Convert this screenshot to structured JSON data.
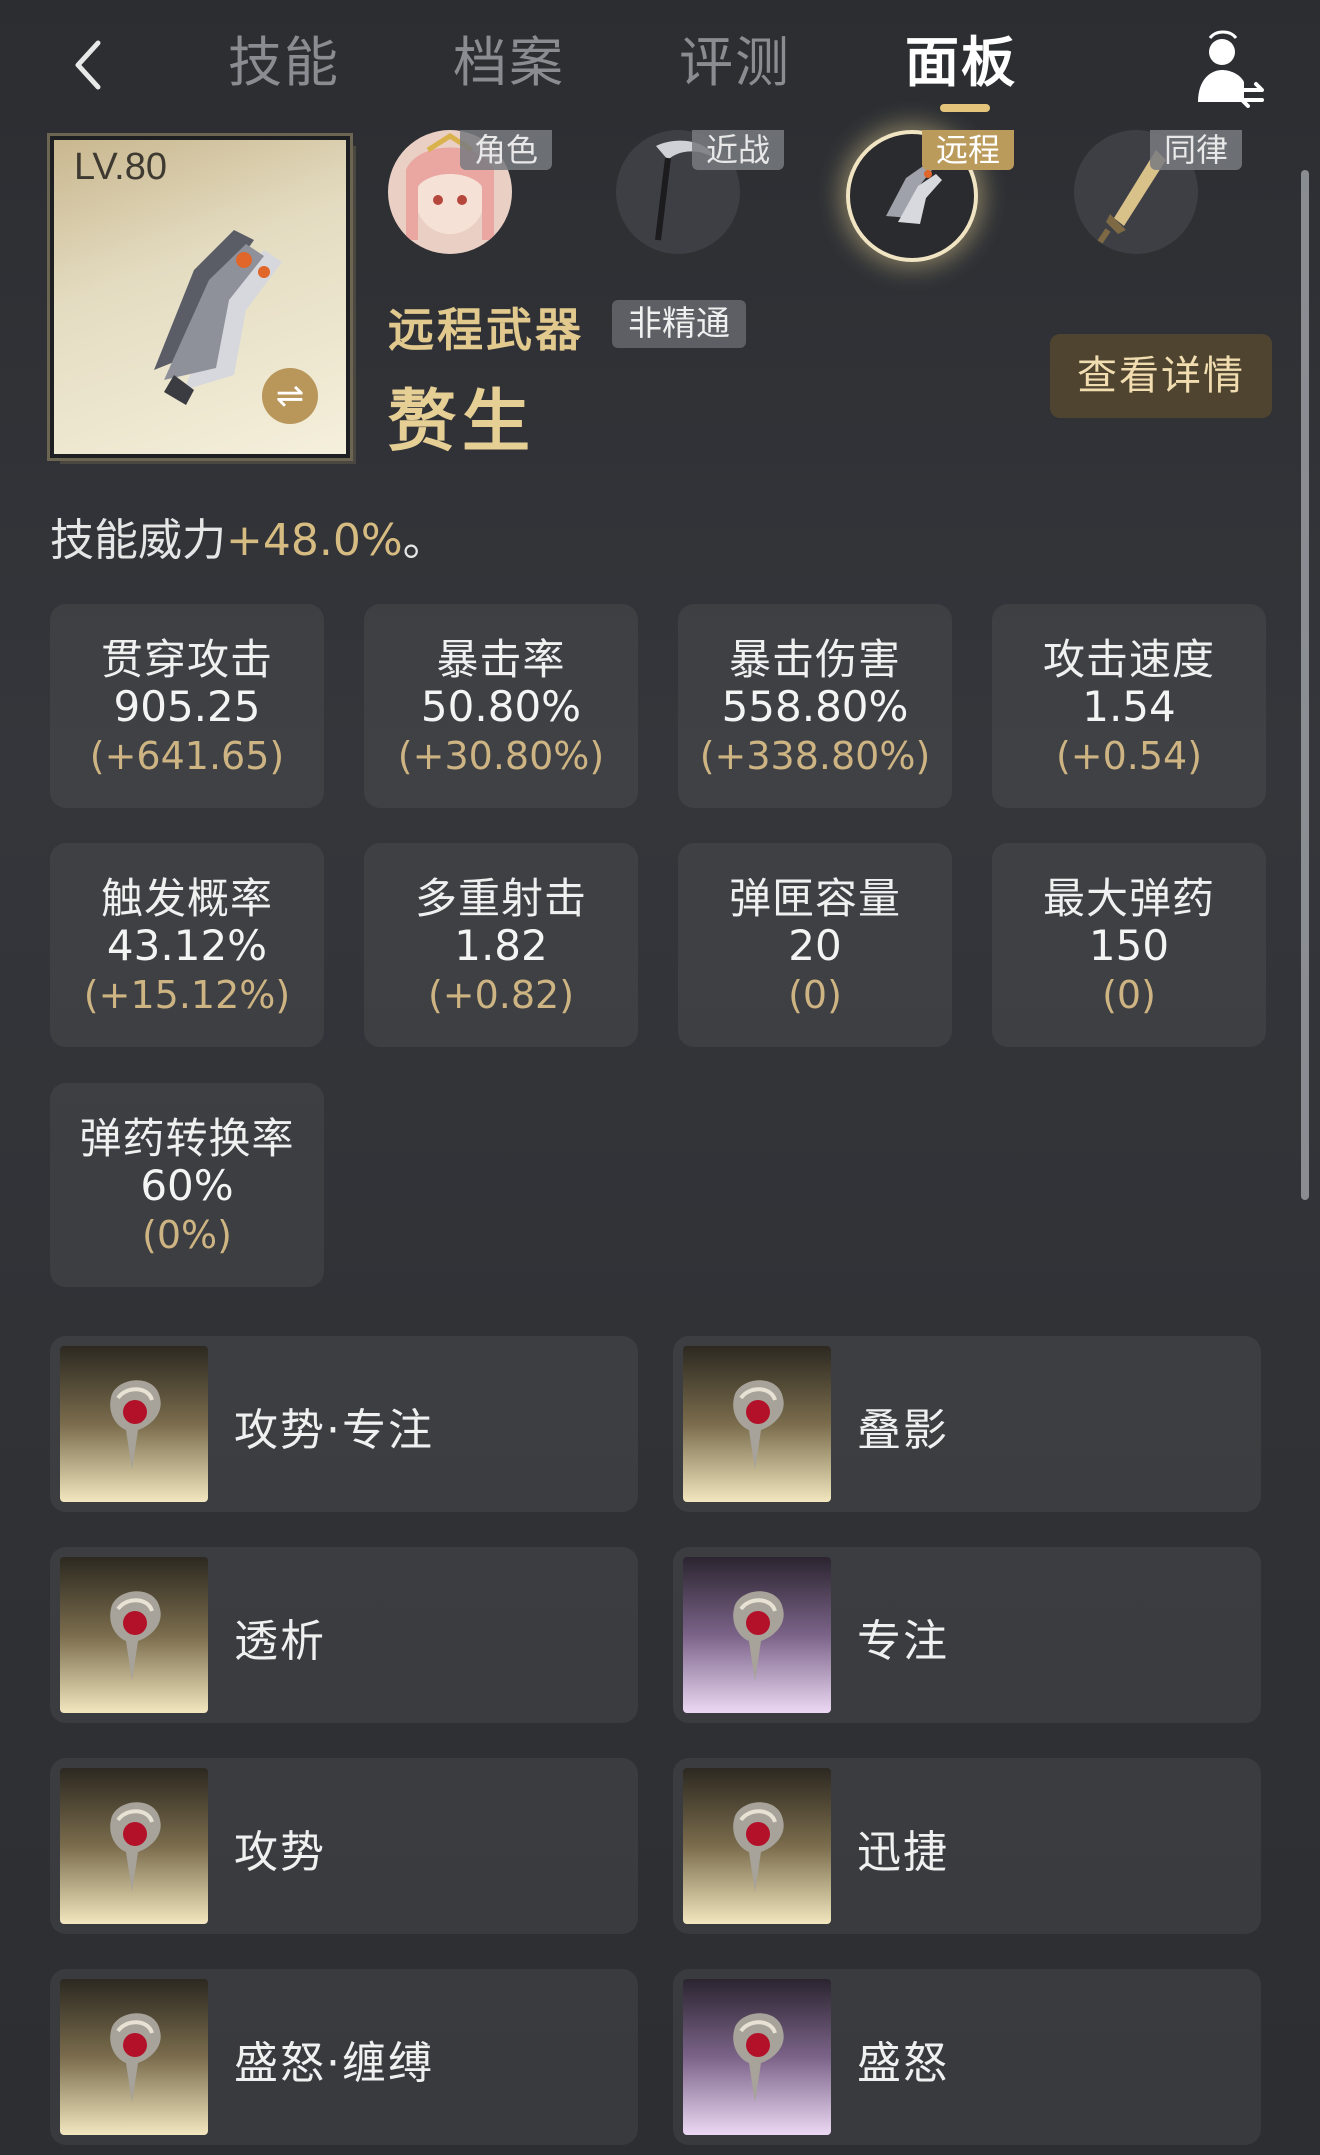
{
  "nav": {
    "tabs": [
      {
        "label": "技能"
      },
      {
        "label": "档案"
      },
      {
        "label": "评测"
      },
      {
        "label": "面板"
      }
    ],
    "active_tab": "面板"
  },
  "equip_slots": [
    {
      "label": "角色",
      "icon": "character-portrait"
    },
    {
      "label": "近战",
      "icon": "scythe-weapon-icon"
    },
    {
      "label": "远程",
      "icon": "pistol-weapon-icon",
      "active": true
    },
    {
      "label": "同律",
      "icon": "sword-weapon-icon"
    }
  ],
  "weapon": {
    "level": "LV.80",
    "type": "远程武器",
    "mastery": "非精通",
    "name": "赘生",
    "detail_button": "查看详情"
  },
  "skill_power": {
    "label": "技能威力",
    "value": "+48.0%",
    "suffix": "。"
  },
  "stats": [
    {
      "name": "贯穿攻击",
      "value": "905.25",
      "bonus": "(+641.65)"
    },
    {
      "name": "暴击率",
      "value": "50.80%",
      "bonus": "(+30.80%)"
    },
    {
      "name": "暴击伤害",
      "value": "558.80%",
      "bonus": "(+338.80%)"
    },
    {
      "name": "攻击速度",
      "value": "1.54",
      "bonus": "(+0.54)"
    },
    {
      "name": "触发概率",
      "value": "43.12%",
      "bonus": "(+15.12%)"
    },
    {
      "name": "多重射击",
      "value": "1.82",
      "bonus": "(+0.82)"
    },
    {
      "name": "弹匣容量",
      "value": "20",
      "bonus": "(0)"
    },
    {
      "name": "最大弹药",
      "value": "150",
      "bonus": "(0)"
    },
    {
      "name": "弹药转换率",
      "value": "60%",
      "bonus": "(0%)"
    }
  ],
  "traits": [
    {
      "name": "攻势·专注",
      "tier": "gold"
    },
    {
      "name": "叠影",
      "tier": "gold"
    },
    {
      "name": "透析",
      "tier": "gold"
    },
    {
      "name": "专注",
      "tier": "purple"
    },
    {
      "name": "攻势",
      "tier": "gold"
    },
    {
      "name": "迅捷",
      "tier": "gold"
    },
    {
      "name": "盛怒·缠缚",
      "tier": "gold"
    },
    {
      "name": "盛怒",
      "tier": "purple"
    }
  ],
  "colors": {
    "accent_gold": "#e3c47a",
    "bonus_text": "#cdb482",
    "detail_button_bg": "#4e4430"
  }
}
